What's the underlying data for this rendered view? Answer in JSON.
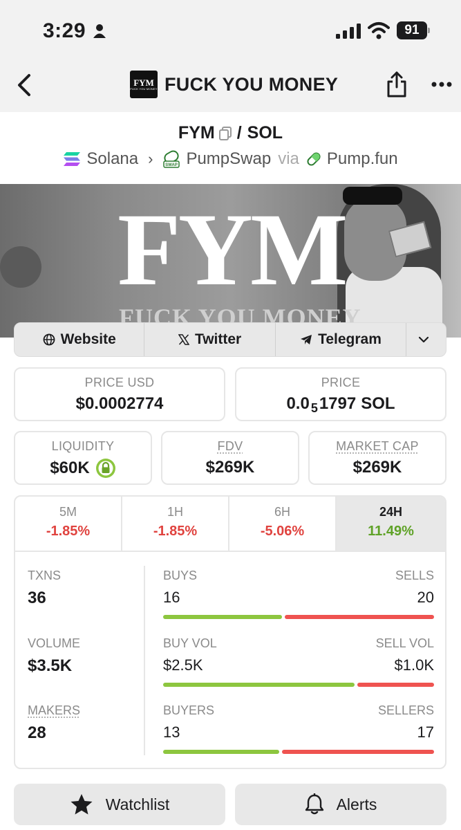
{
  "status_bar": {
    "time": "3:29",
    "battery": "91"
  },
  "nav": {
    "title": "FUCK YOU MONEY",
    "logo_text": "FYM",
    "logo_sub": "FUCK YOU MONEY"
  },
  "pair": {
    "base": "FYM",
    "separator": "/",
    "quote": "SOL"
  },
  "chain": {
    "network": "Solana",
    "dex": "PumpSwap",
    "via": "via",
    "launchpad": "Pump.fun"
  },
  "banner": {
    "title": "FYM",
    "subtitle": "FUCK YOU MONEY"
  },
  "links": {
    "website": "Website",
    "twitter": "Twitter",
    "telegram": "Telegram"
  },
  "price": {
    "usd_label": "PRICE USD",
    "usd_value": "$0.0002774",
    "native_label": "PRICE",
    "native_prefix": "0.0",
    "native_subscript": "5",
    "native_digits": "1797",
    "native_unit": "SOL"
  },
  "metrics": {
    "liquidity_label": "LIQUIDITY",
    "liquidity_value": "$60K",
    "fdv_label": "FDV",
    "fdv_value": "$269K",
    "mcap_label": "MARKET CAP",
    "mcap_value": "$269K"
  },
  "changes": [
    {
      "label": "5M",
      "value": "-1.85%"
    },
    {
      "label": "1H",
      "value": "-1.85%"
    },
    {
      "label": "6H",
      "value": "-5.06%"
    },
    {
      "label": "24H",
      "value": "11.49%"
    }
  ],
  "stats": {
    "txns_label": "TXNS",
    "txns_value": "36",
    "buys_label": "BUYS",
    "buys_value": "16",
    "sells_label": "SELLS",
    "sells_value": "20",
    "volume_label": "VOLUME",
    "volume_value": "$3.5K",
    "buy_vol_label": "BUY VOL",
    "buy_vol_value": "$2.5K",
    "sell_vol_label": "SELL VOL",
    "sell_vol_value": "$1.0K",
    "makers_label": "MAKERS",
    "makers_value": "28",
    "buyers_label": "BUYERS",
    "buyers_value": "13",
    "sellers_label": "SELLERS",
    "sellers_value": "17",
    "buys_ratio": 0.444,
    "buy_vol_ratio": 0.714,
    "buyers_ratio": 0.433
  },
  "actions": {
    "watchlist": "Watchlist",
    "alerts": "Alerts"
  },
  "colors": {
    "positive": "#5fa227",
    "negative": "#e0433f",
    "buy_bar": "#8dc63f",
    "sell_bar": "#ef5350"
  }
}
